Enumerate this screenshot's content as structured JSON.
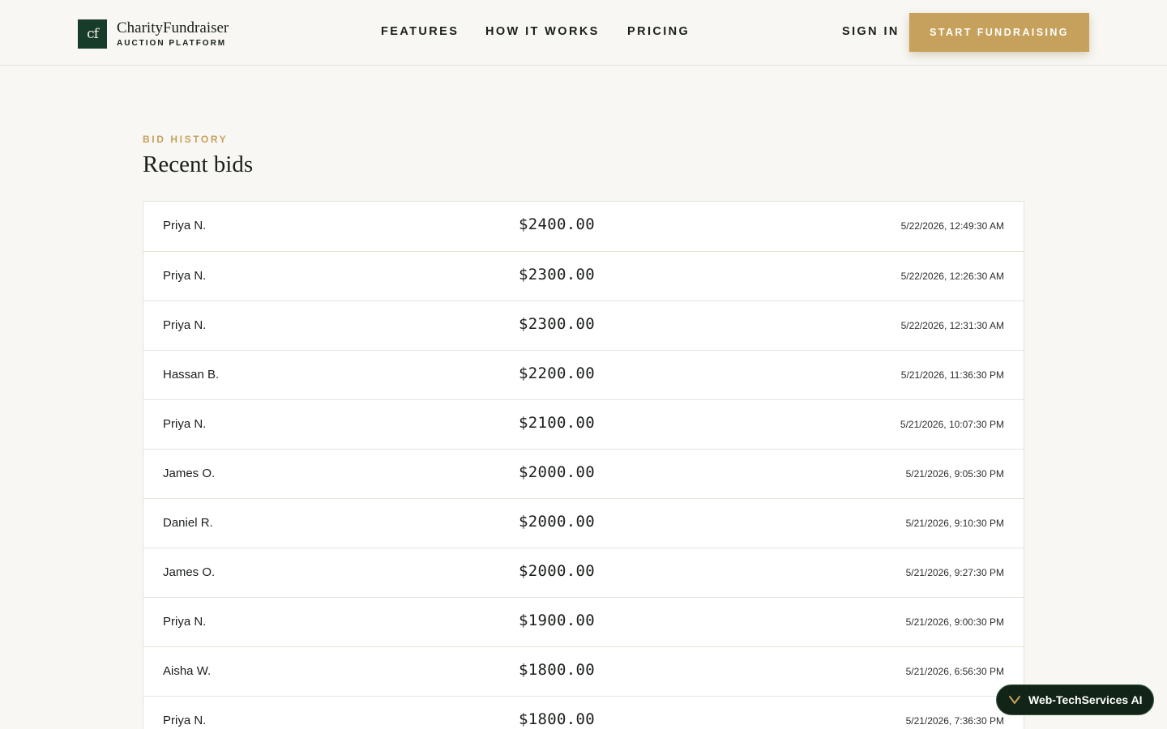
{
  "header": {
    "logo_mark": "cf",
    "logo_name": "CharityFundraiser",
    "logo_tagline": "AUCTION PLATFORM",
    "nav": [
      {
        "label": "FEATURES"
      },
      {
        "label": "HOW IT WORKS"
      },
      {
        "label": "PRICING"
      }
    ],
    "sign_in": "SIGN IN",
    "cta": "START FUNDRAISING"
  },
  "section": {
    "eyebrow": "BID HISTORY",
    "title": "Recent bids"
  },
  "bids": [
    {
      "bidder": "Priya N.",
      "amount": "$2400.00",
      "time": "5/22/2026, 12:49:30 AM"
    },
    {
      "bidder": "Priya N.",
      "amount": "$2300.00",
      "time": "5/22/2026, 12:26:30 AM"
    },
    {
      "bidder": "Priya N.",
      "amount": "$2300.00",
      "time": "5/22/2026, 12:31:30 AM"
    },
    {
      "bidder": "Hassan B.",
      "amount": "$2200.00",
      "time": "5/21/2026, 11:36:30 PM"
    },
    {
      "bidder": "Priya N.",
      "amount": "$2100.00",
      "time": "5/21/2026, 10:07:30 PM"
    },
    {
      "bidder": "James O.",
      "amount": "$2000.00",
      "time": "5/21/2026, 9:05:30 PM"
    },
    {
      "bidder": "Daniel R.",
      "amount": "$2000.00",
      "time": "5/21/2026, 9:10:30 PM"
    },
    {
      "bidder": "James O.",
      "amount": "$2000.00",
      "time": "5/21/2026, 9:27:30 PM"
    },
    {
      "bidder": "Priya N.",
      "amount": "$1900.00",
      "time": "5/21/2026, 9:00:30 PM"
    },
    {
      "bidder": "Aisha W.",
      "amount": "$1800.00",
      "time": "5/21/2026, 6:56:30 PM"
    },
    {
      "bidder": "Priya N.",
      "amount": "$1800.00",
      "time": "5/21/2026, 7:36:30 PM"
    }
  ],
  "assistant": {
    "label": "Web-TechServices AI",
    "icon": "chevron-down-icon"
  },
  "colors": {
    "brand_green": "#173d2a",
    "accent_gold": "#c6a15b",
    "background": "#f8f7f3"
  }
}
